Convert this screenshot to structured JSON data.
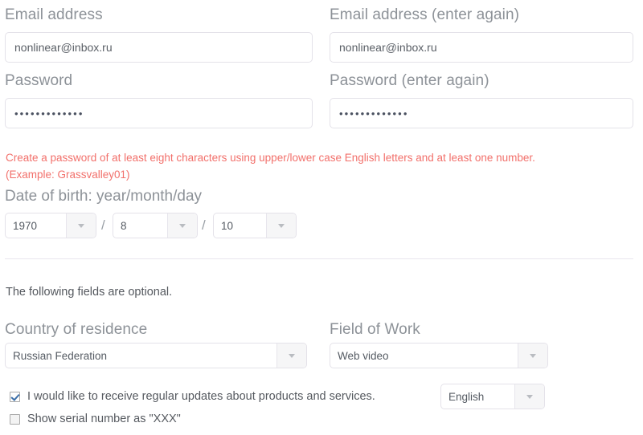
{
  "form": {
    "fields": {
      "email": {
        "label": "Email address",
        "value": "nonlinear@inbox.ru",
        "placeholder": ""
      },
      "email_confirm": {
        "label": "Email address (enter again)",
        "value": "nonlinear@inbox.ru",
        "placeholder": ""
      },
      "password": {
        "label": "Password",
        "value": "•••••••••••••",
        "placeholder": ""
      },
      "password_confirm": {
        "label": "Password (enter again)",
        "value": "•••••••••••••",
        "placeholder": ""
      }
    },
    "password_hint": {
      "line1": "Create a password of at least eight characters using upper/lower case English letters and at least one number.",
      "line2": "(Example: Grassvalley01)",
      "color": "#f2706b"
    },
    "date_of_birth": {
      "heading": "Date of birth: year/month/day",
      "separator": "/",
      "year": {
        "label": "year",
        "value": "1970"
      },
      "month": {
        "label": "month",
        "value": "8"
      },
      "day": {
        "label": "day",
        "value": "10"
      }
    },
    "optional_section": {
      "note": "The following fields are optional.",
      "country": {
        "label": "Country of residence",
        "value": "Russian Federation"
      },
      "field_of_work": {
        "label": "Field of Work",
        "value": "Web video"
      }
    },
    "checkboxes": [
      {
        "label": "I would like to receive regular updates about products and services.",
        "checked": true
      },
      {
        "label": "Show serial number as \"XXX\"",
        "checked": false
      }
    ],
    "language_select": {
      "value": "English"
    }
  },
  "icons": {
    "dropdown_arrow": "chevron-down-icon",
    "checkmark": "check-icon"
  },
  "colors": {
    "label": "#8d9298",
    "hint": "#f2706b",
    "border": "#e4e2e9",
    "arrow_bg": "#f6f6f7",
    "text": "#55595f",
    "divider": "#e8e5ee",
    "check": "#3a6ea8"
  }
}
